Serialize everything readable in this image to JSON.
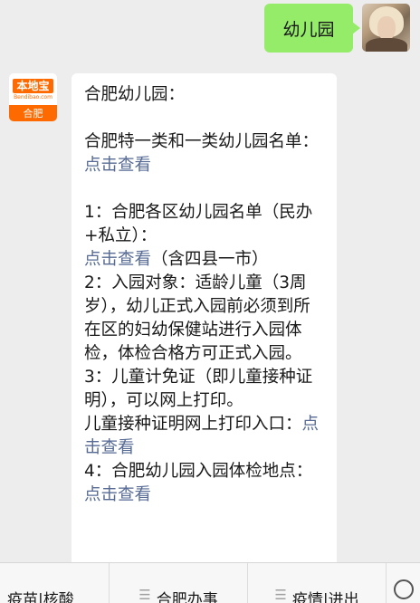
{
  "chat": {
    "outgoing": {
      "text": "幼儿园"
    },
    "bot": {
      "avatar_logo_main": "本地宝",
      "avatar_logo_sub": "Bendibao.com",
      "avatar_city": "合肥"
    },
    "incoming": {
      "title": "合肥幼儿园：",
      "intro_text": "合肥特一类和一类幼儿园名单：",
      "intro_link": "点击查看",
      "item1_text": "1：合肥各区幼儿园名单（民办+私立）：",
      "item1_link": "点击查看",
      "item1_suffix": "（含四县一市）",
      "item2_text": "2：入园对象：适龄儿童（3周岁），幼儿正式入园前必须到所在区的妇幼保健站进行入园体检，体检合格方可正式入园。",
      "item3_text": "3：儿童计免证（即儿童接种证明），可以网上打印。",
      "item3_sub": "儿童接种证明网上打印入口：",
      "item3_link": "点击查看",
      "item4_text": "4：合肥幼儿园入园体检地点：",
      "item4_link": "点击查看"
    }
  },
  "menu": {
    "items": [
      "疫苗|核酸",
      "合肥办事",
      "疫情|进出"
    ],
    "keyboard_icon": "keyboard-icon"
  }
}
